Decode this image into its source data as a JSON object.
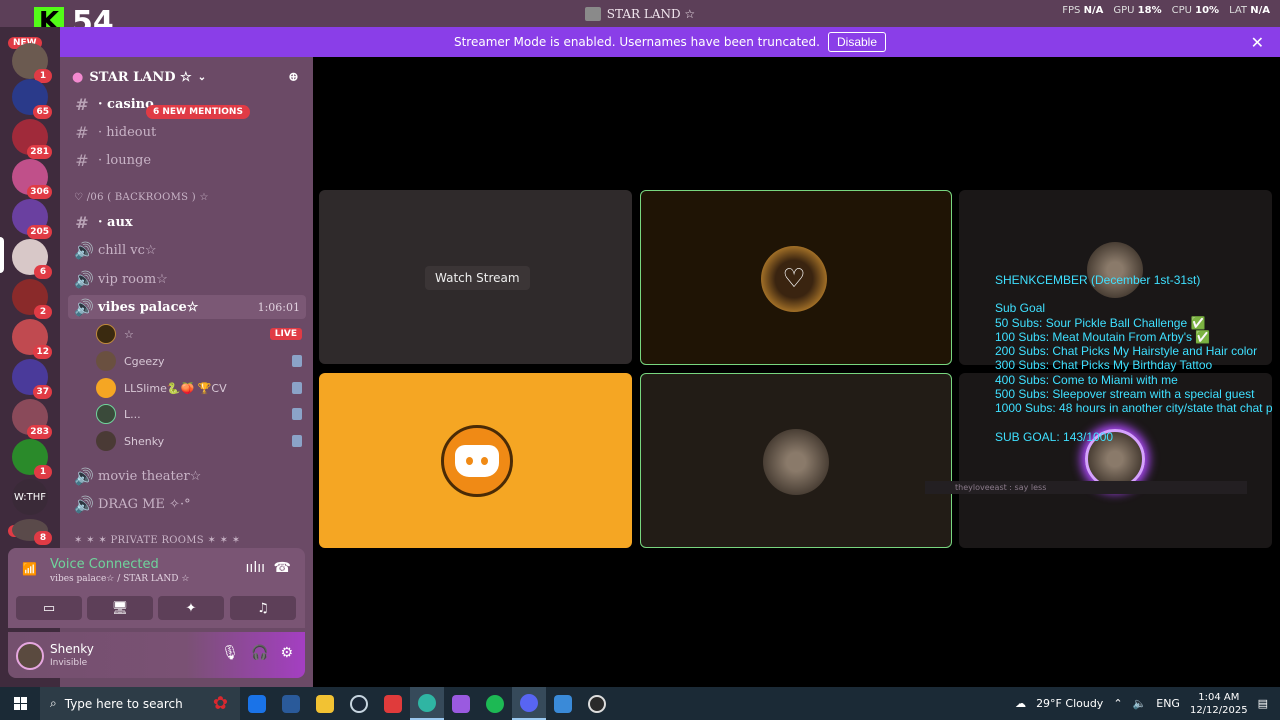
{
  "window": {
    "title": "STAR LAND ☆"
  },
  "overlay": {
    "logo_letter": "K",
    "count": "54"
  },
  "perf": {
    "fps_label": "FPS",
    "fps_value": "N/A",
    "gpu_label": "GPU",
    "gpu_value": "18%",
    "cpu_label": "CPU",
    "cpu_value": "10%",
    "lat_label": "LAT",
    "lat_value": "N/A"
  },
  "banner": {
    "text": "Streamer Mode is enabled. Usernames have been truncated.",
    "button": "Disable"
  },
  "rail": {
    "new_top": "NEW",
    "new_bottom": "NEW",
    "wthf": "W:THF",
    "badges": [
      "1",
      "65",
      "281",
      "306",
      "205",
      "6",
      "2",
      "12",
      "37",
      "283",
      "1",
      "8"
    ]
  },
  "guild": {
    "name": "STAR LAND ☆"
  },
  "mentions": "6 NEW MENTIONS",
  "channels": {
    "casino": "· casino",
    "hideout": "· hideout",
    "lounge": "· lounge",
    "cat_backrooms": "♡ /06 ( BACKROOMS ) ☆",
    "aux": "· aux",
    "chill": "chill vc☆",
    "vip": "vip room☆",
    "vibes": "vibes palace☆",
    "vibes_time": "1:06:01",
    "movie": "movie theater☆",
    "drag": "DRAG ME ✧·°",
    "cat_private": "✶ ✶ ✶ PRIVATE ROOMS ✶ ✶ ✶"
  },
  "voice_users": [
    {
      "name": "☆",
      "live": "LIVE"
    },
    {
      "name": "Cgeezy"
    },
    {
      "name": "LLSlime🐍🍑 🏆CV"
    },
    {
      "name": "L..."
    },
    {
      "name": "Shenky"
    }
  ],
  "voice": {
    "status": "Voice Connected",
    "location": "vibes palace☆ / STAR LAND ☆"
  },
  "user": {
    "name": "Shenky",
    "status": "Invisible"
  },
  "stage": {
    "watch": "Watch Stream",
    "goal_lines": [
      "SHENKCEMBER (December 1st-31st)",
      "",
      "Sub Goal",
      " 50 Subs: Sour Pickle Ball Challenge ✅",
      "100 Subs: Meat Moutain From Arby's ✅",
      "200 Subs: Chat Picks My Hairstyle and Hair color",
      "300 Subs: Chat Picks My Birthday Tattoo",
      "400 Subs: Come to Miami with me",
      "500 Subs: Sleepover stream with a special guest",
      "1000 Subs: 48 hours in another city/state that chat p",
      "",
      "SUB GOAL: 143/1000"
    ],
    "chat_line": "theyloveeast : say less"
  },
  "taskbar": {
    "search_placeholder": "Type here to search",
    "weather": "29°F  Cloudy",
    "lang": "ENG",
    "time": "1:04 AM",
    "date": "12/12/2025"
  }
}
